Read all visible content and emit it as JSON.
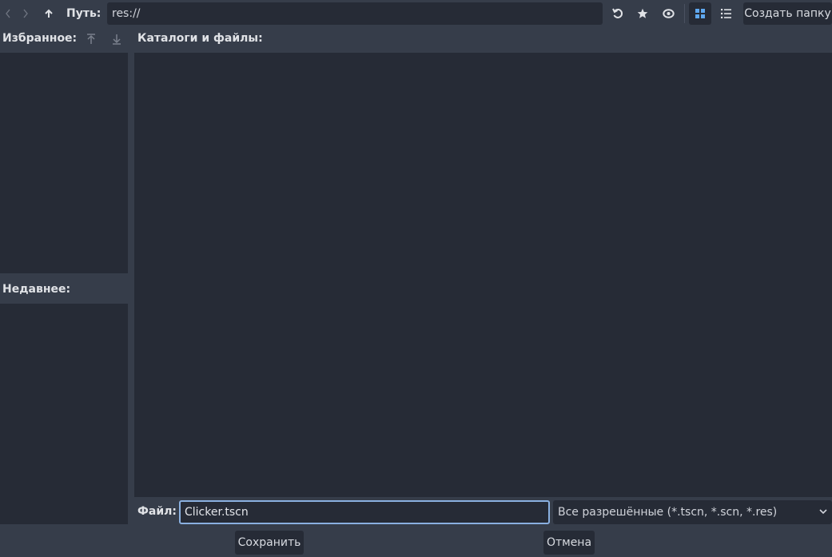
{
  "toolbar": {
    "path_label": "Путь:",
    "path_value": "res://",
    "new_folder_label": "Создать папку",
    "icons": [
      "back-icon",
      "forward-icon",
      "up-icon",
      "refresh-icon",
      "star-icon",
      "eye-icon",
      "grid-view-icon",
      "list-view-icon"
    ]
  },
  "favorites": {
    "title": "Избранное:"
  },
  "recent": {
    "title": "Недавнее:"
  },
  "files": {
    "title": "Каталоги и файлы:"
  },
  "file_row": {
    "label": "Файл:",
    "filename": "Clicker.tscn",
    "filter": "Все разрешённые (*.tscn, *.scn, *.res)"
  },
  "buttons": {
    "save": "Сохранить",
    "cancel": "Отмена"
  },
  "colors": {
    "background": "#363d4a",
    "panel": "#262b36",
    "focus": "#8ab0e0",
    "accent": "#5fa8ef"
  }
}
